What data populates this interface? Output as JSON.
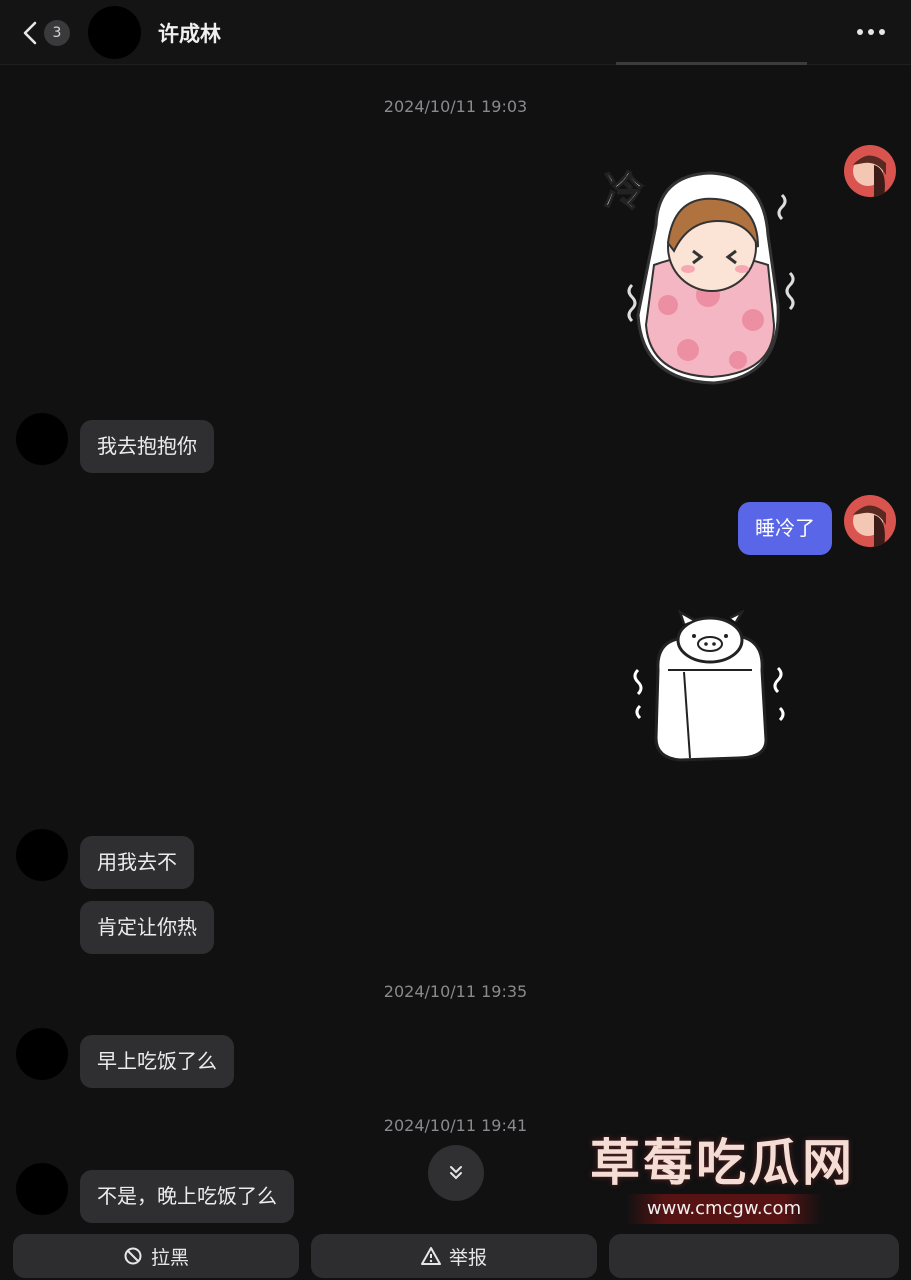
{
  "header": {
    "unread_count": "3",
    "contact_name": "许成林"
  },
  "messages": {
    "t1": "2024/10/11 19:03",
    "m1": "我去抱抱你",
    "m2": "睡冷了",
    "m3": "用我去不",
    "m4": "肯定让你热",
    "t2": "2024/10/11 19:35",
    "m5": "早上吃饭了么",
    "t3": "2024/10/11 19:41",
    "m6": "不是，晚上吃饭了么"
  },
  "stickers": {
    "s1_text": "冷"
  },
  "actions": {
    "block_label": "拉黑",
    "report_label": "举报"
  },
  "watermark": {
    "title": "草莓吃瓜网",
    "url": "www.cmcgw.com"
  },
  "colors": {
    "background": "#111112",
    "incoming_bubble": "#2f2f31",
    "outgoing_bubble": "#5a66e8"
  }
}
